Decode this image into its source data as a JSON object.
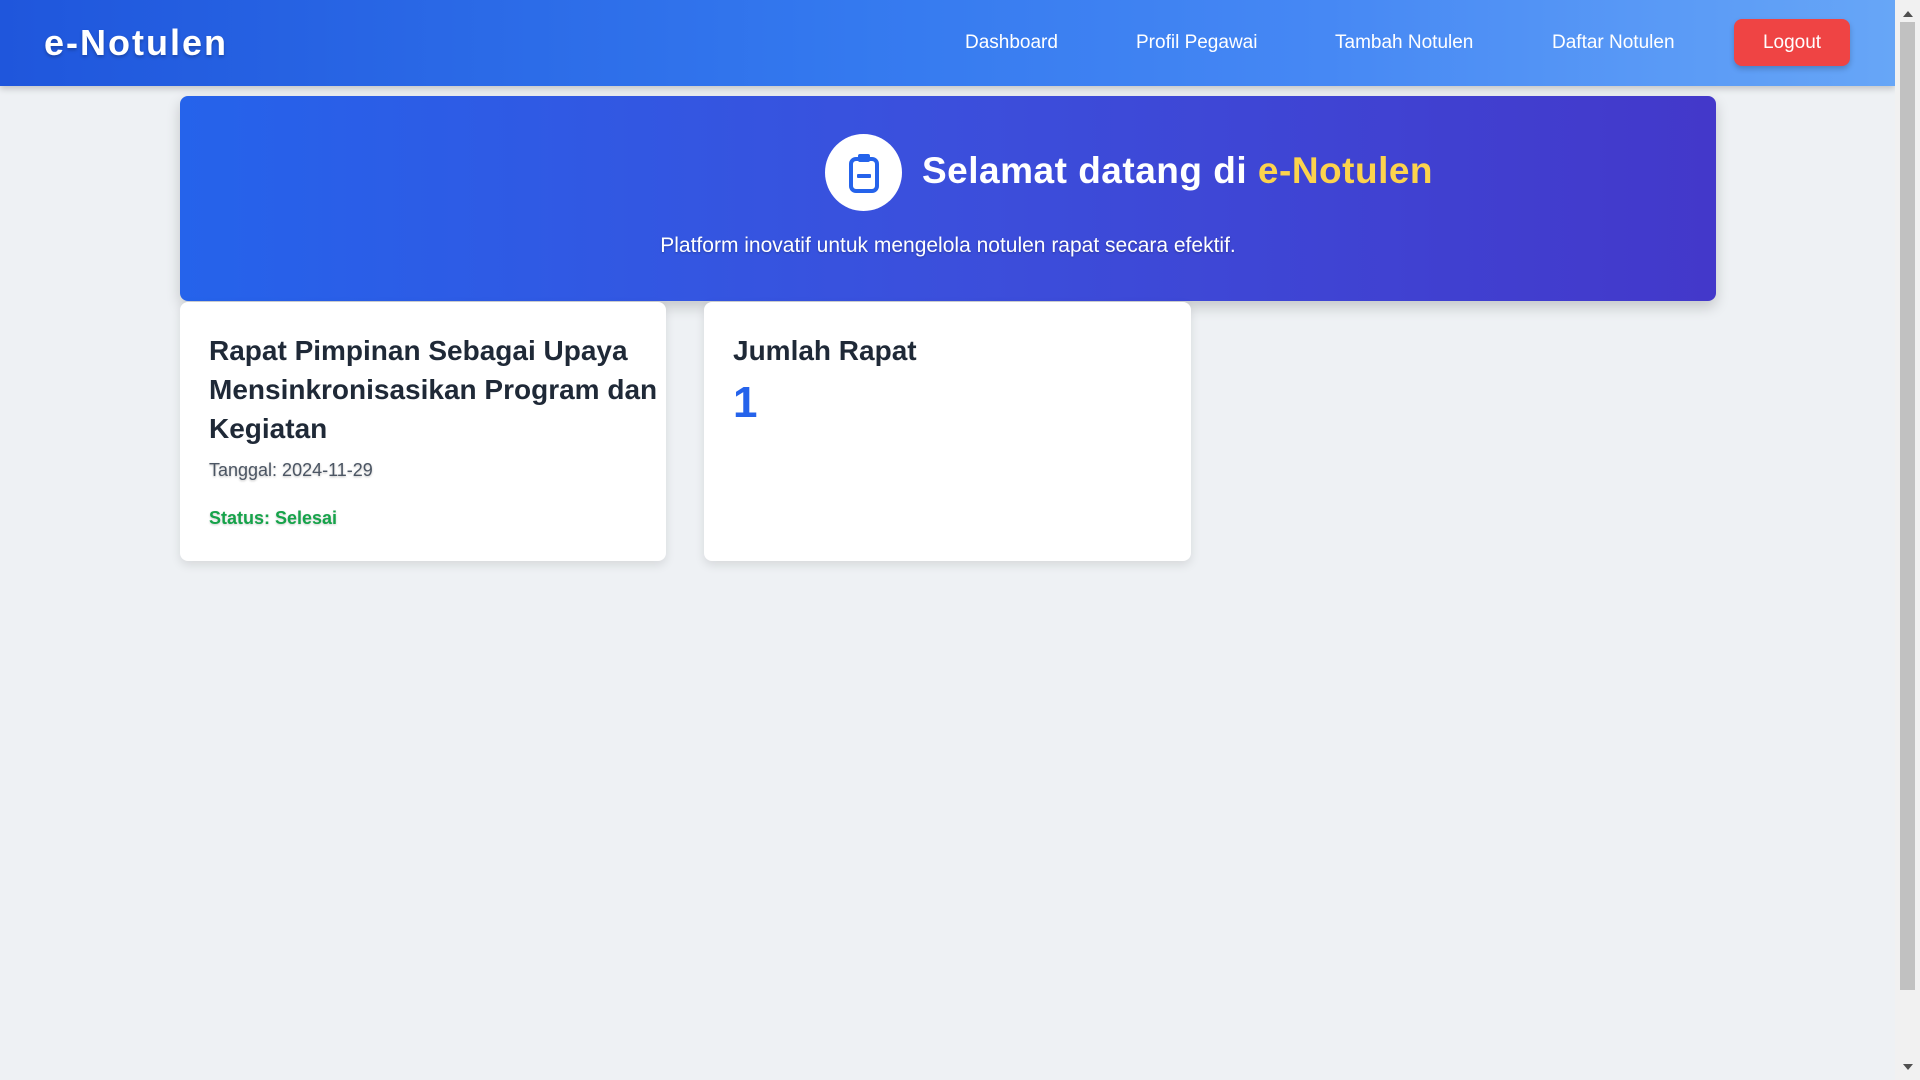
{
  "navbar": {
    "brand": "e-Notulen",
    "links": [
      "Dashboard",
      "Profil Pegawai",
      "Tambah Notulen",
      "Daftar Notulen"
    ],
    "logout_label": "Logout"
  },
  "hero": {
    "icon": "clipboard-icon",
    "title_prefix": "Selamat datang di ",
    "title_accent": "e-Notulen",
    "subtitle": "Platform inovatif untuk mengelola notulen rapat secara efektif."
  },
  "cards": {
    "meeting": {
      "title": "Rapat Pimpinan Sebagai Upaya Mensinkronisasikan Program dan Kegiatan",
      "date": "Tanggal: 2024-11-29",
      "status": "Status: Selesai"
    },
    "count": {
      "label": "Jumlah Rapat",
      "value": "1"
    }
  },
  "colors": {
    "logout": "#ef4444",
    "accent_yellow": "#fcd34d",
    "status_green": "#16a34a",
    "count_blue": "#2563eb"
  }
}
